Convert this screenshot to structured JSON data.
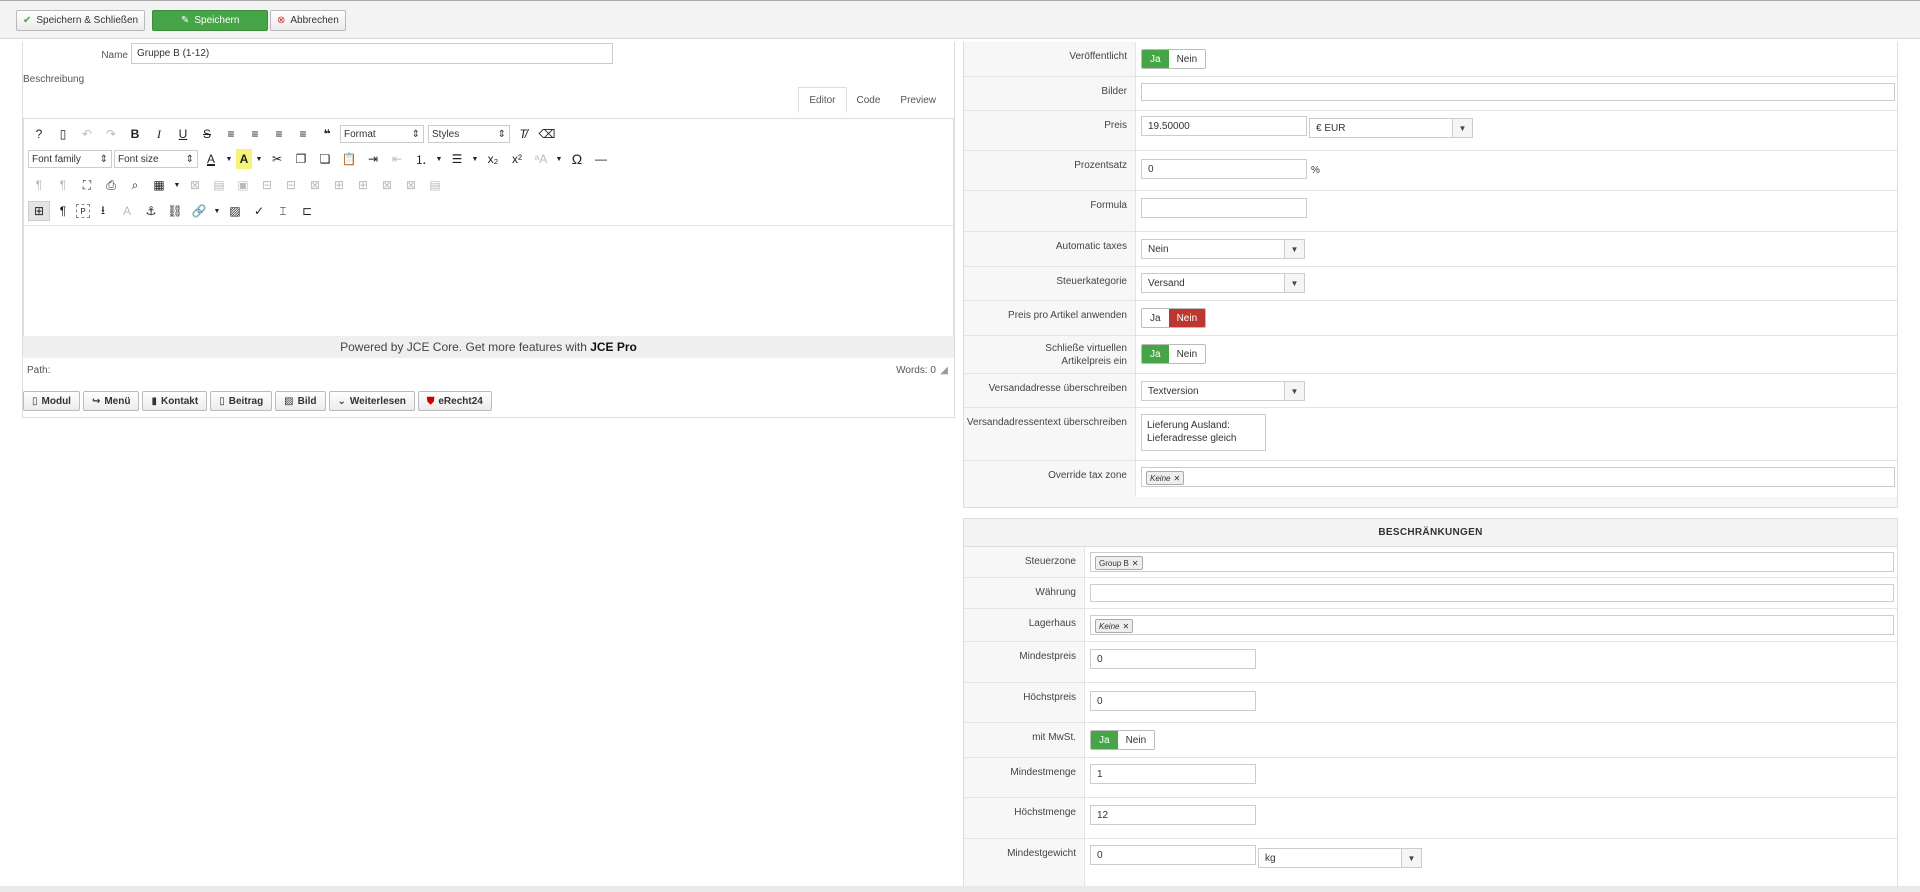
{
  "toolbar": {
    "save_close": "Speichern & Schließen",
    "save": "Speichern",
    "cancel": "Abbrechen"
  },
  "left": {
    "name_label": "Name",
    "name_value": "Gruppe B (1-12)",
    "desc_label": "Beschreibung",
    "tabs": {
      "editor": "Editor",
      "code": "Code",
      "preview": "Preview"
    },
    "format_select": "Format",
    "styles_select": "Styles",
    "font_family": "Font family",
    "font_size": "Font size",
    "powered_prefix": "Powered by JCE Core. Get more features with ",
    "powered_bold": "JCE Pro",
    "path_label": "Path:",
    "words_label": "Words: 0",
    "buttons": {
      "modul": "Modul",
      "menu": "Menü",
      "kontakt": "Kontakt",
      "beitrag": "Beitrag",
      "bild": "Bild",
      "weiterlesen": "Weiterlesen",
      "erecht": "eRecht24"
    }
  },
  "right": {
    "published": {
      "label": "Veröffentlicht",
      "yes": "Ja",
      "no": "Nein"
    },
    "images": {
      "label": "Bilder"
    },
    "price": {
      "label": "Preis",
      "value": "19.50000",
      "currency": "€ EUR"
    },
    "percent": {
      "label": "Prozentsatz",
      "value": "0",
      "unit": "%"
    },
    "formula": {
      "label": "Formula"
    },
    "auto_taxes": {
      "label": "Automatic taxes",
      "value": "Nein"
    },
    "tax_category": {
      "label": "Steuerkategorie",
      "value": "Versand"
    },
    "price_per_item": {
      "label": "Preis pro Artikel anwenden",
      "yes": "Ja",
      "no": "Nein"
    },
    "virtual_price": {
      "label1": "Schließe virtuellen",
      "label2": "Artikelpreis ein",
      "yes": "Ja",
      "no": "Nein"
    },
    "ship_addr": {
      "label": "Versandadresse überschreiben",
      "value": "Textversion"
    },
    "ship_text": {
      "label": "Versandadressentext überschreiben",
      "line1": "Lieferung Ausland:",
      "line2": "Lieferadresse gleich"
    },
    "override_tax": {
      "label": "Override tax zone",
      "chip": "Keine"
    }
  },
  "restrictions": {
    "title": "BESCHRÄNKUNGEN",
    "tax_zone": {
      "label": "Steuerzone",
      "chip": "Group B"
    },
    "currency": {
      "label": "Währung"
    },
    "warehouse": {
      "label": "Lagerhaus",
      "chip": "Keine"
    },
    "min_price": {
      "label": "Mindestpreis",
      "value": "0"
    },
    "max_price": {
      "label": "Höchstpreis",
      "value": "0"
    },
    "with_vat": {
      "label": "mit MwSt.",
      "yes": "Ja",
      "no": "Nein"
    },
    "min_qty": {
      "label": "Mindestmenge",
      "value": "1"
    },
    "max_qty": {
      "label": "Höchstmenge",
      "value": "12"
    },
    "min_weight": {
      "label": "Mindestgewicht",
      "value": "0",
      "unit": "kg"
    }
  }
}
